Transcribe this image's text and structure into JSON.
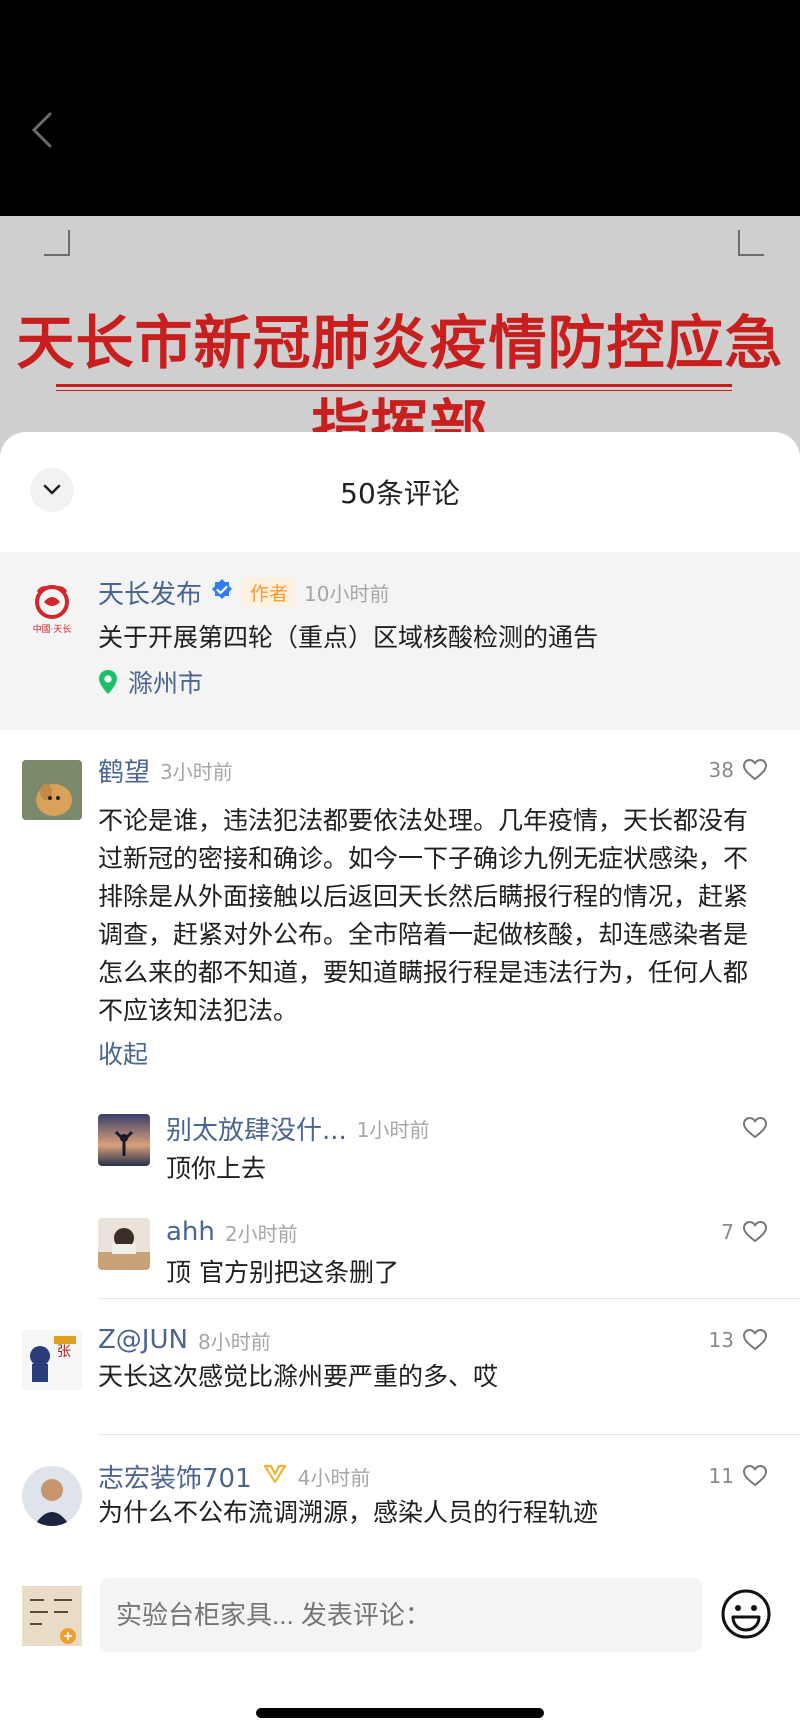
{
  "doc": {
    "title": "天长市新冠肺炎疫情防控应急指挥部"
  },
  "sheet": {
    "title": "50条评论"
  },
  "post": {
    "author": "天长发布",
    "author_tag": "作者",
    "time": "10小时前",
    "text": "关于开展第四轮（重点）区域核酸检测的通告",
    "location": "滁州市",
    "avatar_text": "中國·天长"
  },
  "comments": [
    {
      "name": "鹤望",
      "time": "3小时前",
      "likes": "38",
      "text": "不论是谁，违法犯法都要依法处理。几年疫情，天长都没有过新冠的密接和确诊。如今一下子确诊九例无症状感染，不排除是从外面接触以后返回天长然后瞒报行程的情况，赶紧调查，赶紧对外公布。全市陪着一起做核酸，却连感染者是怎么来的都不知道，要知道瞒报行程是违法行为，任何人都不应该知法犯法。",
      "collapse": "收起",
      "replies": [
        {
          "name": "别太放肆没什...",
          "time": "1小时前",
          "likes": "",
          "text": "顶你上去"
        },
        {
          "name": "ahh",
          "time": "2小时前",
          "likes": "7",
          "text": "顶 官方别把这条删了"
        }
      ]
    },
    {
      "name": "Z@JUN",
      "time": "8小时前",
      "likes": "13",
      "text": "天长这次感觉比滁州要严重的多、哎"
    },
    {
      "name": "志宏装饰701",
      "time": "4小时前",
      "likes": "11",
      "text": "为什么不公布流调溯源，感染人员的行程轨迹"
    }
  ],
  "input": {
    "placeholder": "实验台柜家具... 发表评论："
  },
  "colors": {
    "name": "#4a6590",
    "doc_red": "#c81e1e",
    "author_tag": "#ff9a2e",
    "verified": "#2f7cf6",
    "location_pin": "#1fbf6a"
  }
}
